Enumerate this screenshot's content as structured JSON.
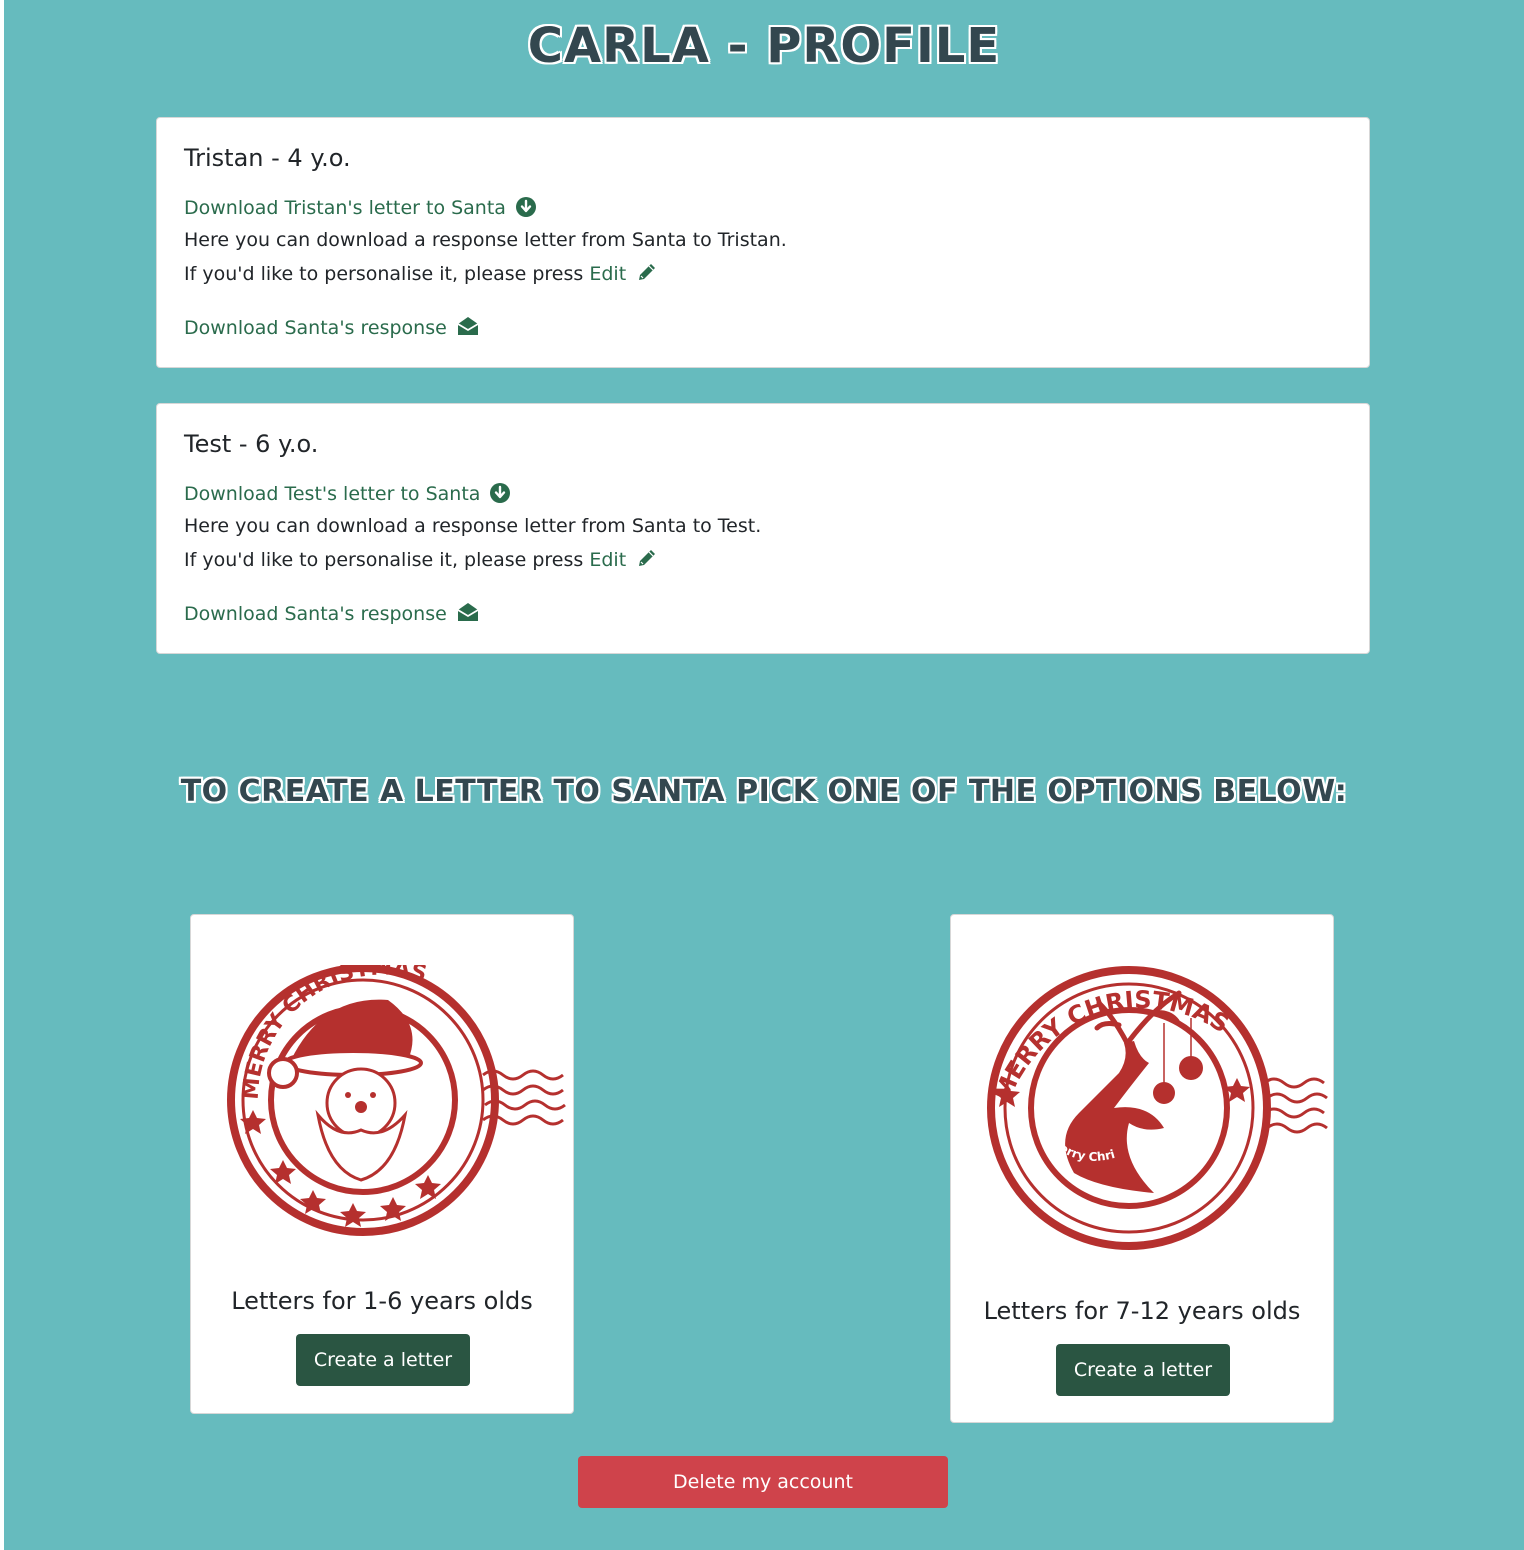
{
  "page": {
    "title": "Carla - Profile",
    "background_color": "#66bbbe"
  },
  "children": [
    {
      "name_heading": "Tristan - 4 y.o.",
      "download_letter_link": "Download Tristan's letter to Santa",
      "response_text": "Here you can download a response letter from Santa to Tristan.",
      "personalise_text": "If you'd like to personalise it, please press",
      "edit_link": "Edit",
      "download_response_link": "Download Santa's response"
    },
    {
      "name_heading": "Test - 6 y.o.",
      "download_letter_link": "Download Test's letter to Santa",
      "response_text": "Here you can download a response letter from Santa to Test.",
      "personalise_text": "If you'd like to personalise it, please press",
      "edit_link": "Edit",
      "download_response_link": "Download Santa's response"
    }
  ],
  "create_section": {
    "heading": "To create a letter to Santa pick one of the options below:",
    "options": [
      {
        "image": "santa-stamp-icon",
        "stamp_text": "MERRY CHRISTMAS",
        "label": "Letters for 1-6 years olds",
        "button_label": "Create a letter"
      },
      {
        "image": "reindeer-stamp-icon",
        "stamp_text": "MERRY CHRISTMAS",
        "stamp_inner_text": "Merry Christmas",
        "label": "Letters for 7-12 years olds",
        "button_label": "Create a letter"
      }
    ]
  },
  "delete_button_label": "Delete my account",
  "colors": {
    "link": "#2a6b4c",
    "create_button": "#2a5542",
    "delete_button": "#cf434b",
    "stamp": "#b5302e",
    "title": "#33474f"
  },
  "icons": {
    "download": "arrow-circle-down-icon",
    "edit": "pencil-icon",
    "response": "envelope-open-icon"
  }
}
